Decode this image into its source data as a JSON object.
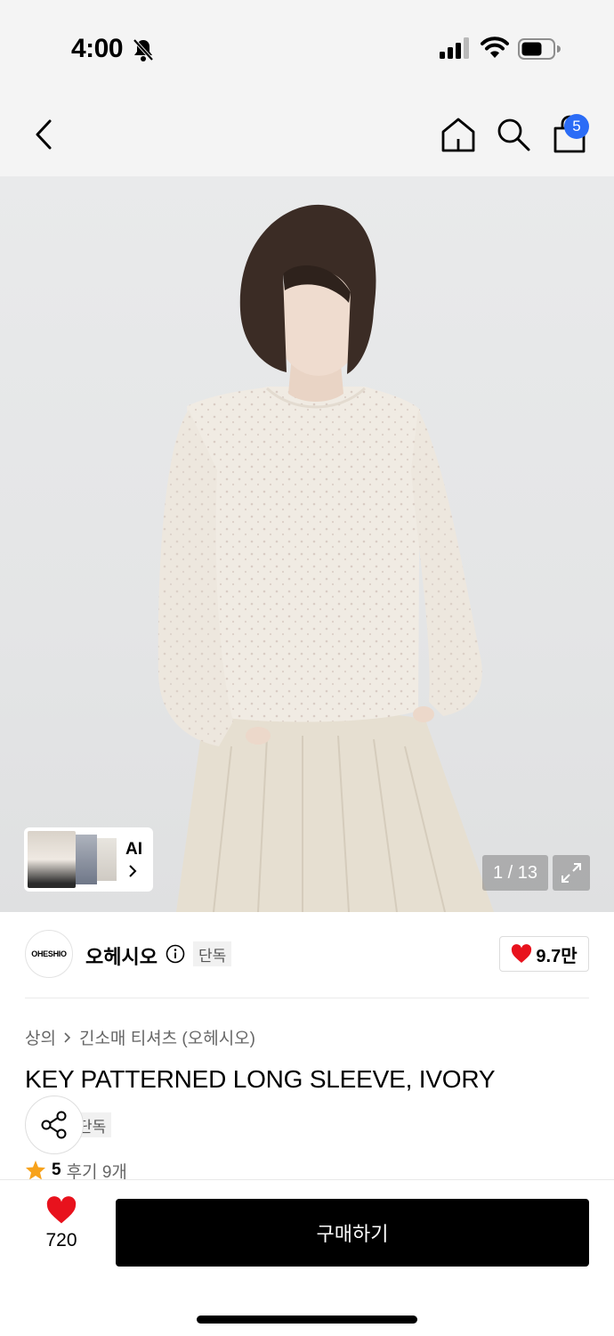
{
  "status_bar": {
    "time": "4:00",
    "icons": [
      "bell-slash-icon",
      "signal-icon",
      "wifi-icon",
      "battery-icon"
    ]
  },
  "nav": {
    "icons": [
      "back-icon",
      "home-icon",
      "search-icon",
      "shopping-bag-icon"
    ],
    "cart_count": "5"
  },
  "gallery": {
    "ai_label": "AI",
    "counter": "1 / 13"
  },
  "brand": {
    "logo_text": "OHESHIO",
    "name": "오헤시오",
    "tag": "단독",
    "likes": "9.7만"
  },
  "product": {
    "breadcrumb": [
      "상의",
      "긴소매 티셔츠 (오헤시오)"
    ],
    "title": "KEY PATTERNED LONG SLEEVE, IVORY",
    "tag": "단독",
    "rating": "5",
    "reviews": "후기 9개"
  },
  "bottom": {
    "wish_count": "720",
    "buy_label": "구매하기"
  },
  "colors": {
    "accent_blue": "#2b6cf6",
    "heart_red": "#e8121d",
    "star": "#f7a21b",
    "black": "#000000"
  }
}
